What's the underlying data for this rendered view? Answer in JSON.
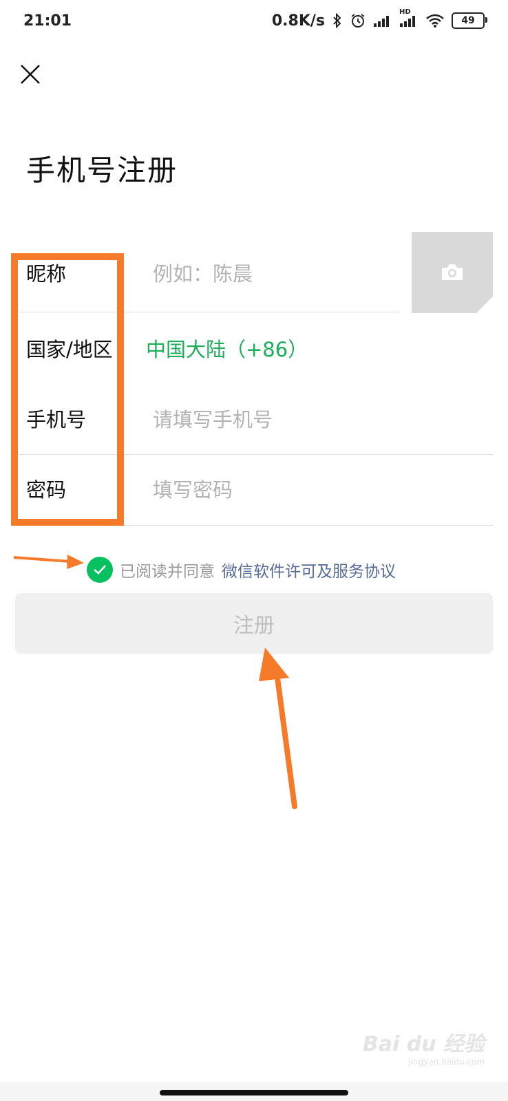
{
  "status_bar": {
    "time": "21:01",
    "net_speed": "0.8K/s",
    "battery": "49",
    "hd_label": "HD",
    "icons": [
      "bluetooth-icon",
      "alarm-icon",
      "signal-icon",
      "hd-signal-icon",
      "wifi-icon",
      "battery-icon"
    ]
  },
  "header": {
    "close_icon": "close-icon",
    "title": "手机号注册"
  },
  "form": {
    "nickname": {
      "label": "昵称",
      "placeholder": "例如：陈晨"
    },
    "region": {
      "label": "国家/地区",
      "value": "中国大陆（+86）"
    },
    "phone": {
      "label": "手机号",
      "placeholder": "请填写手机号"
    },
    "password": {
      "label": "密码",
      "placeholder": "填写密码"
    },
    "avatar_icon": "camera-icon"
  },
  "agreement": {
    "checked": true,
    "text": "已阅读并同意",
    "link": "微信软件许可及服务协议"
  },
  "register_button": {
    "label": "注册"
  },
  "watermark": {
    "text": "Bai du 经验",
    "sub": "jingyan.baidu.com"
  },
  "colors": {
    "accent_green": "#07c160",
    "region_green": "#1aad5a",
    "link_blue": "#576b95",
    "annotation_orange": "#f57a2a",
    "button_bg": "#f0f0f0"
  }
}
